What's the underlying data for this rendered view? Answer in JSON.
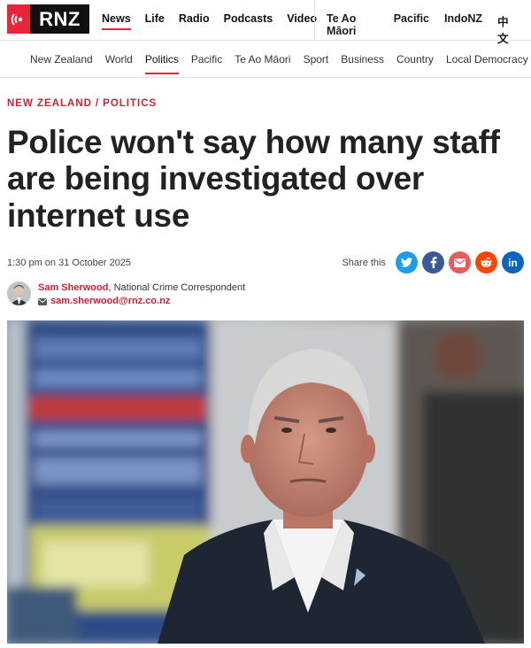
{
  "brand": {
    "logo_text": "RNZ",
    "accent": "#e8263a"
  },
  "main_nav": {
    "primary": [
      "News",
      "Life",
      "Radio",
      "Podcasts",
      "Video"
    ],
    "secondary": [
      "Te Ao Māori",
      "Pacific",
      "IndoNZ",
      "中文"
    ],
    "active": "News"
  },
  "sub_nav": {
    "items": [
      "New Zealand",
      "World",
      "Politics",
      "Pacific",
      "Te Ao Māori",
      "Sport",
      "Business",
      "Country",
      "Local Democracy Rep"
    ],
    "active": "Politics"
  },
  "article": {
    "breadcrumb": [
      "NEW ZEALAND",
      "POLITICS"
    ],
    "breadcrumb_sep": "/",
    "headline": "Police won't say how many staff are being investigated over internet use",
    "dateline": "1:30 pm on 31 October 2025",
    "share_label": "Share this",
    "share_icons": [
      {
        "name": "twitter-icon",
        "glyph": "🐦",
        "color": "#1d9bf0"
      },
      {
        "name": "facebook-icon",
        "glyph": "f",
        "color": "#3b5998"
      },
      {
        "name": "email-icon",
        "glyph": "✉",
        "color": "#e85b5b"
      },
      {
        "name": "reddit-icon",
        "glyph": "●",
        "color": "#ff4500"
      },
      {
        "name": "linkedin-icon",
        "glyph": "in",
        "color": "#0a66c2"
      }
    ],
    "author": {
      "name": "Sam Sherwood",
      "role": ", National Crime Correspondent",
      "email": "sam.sherwood@rnz.co.nz"
    }
  }
}
